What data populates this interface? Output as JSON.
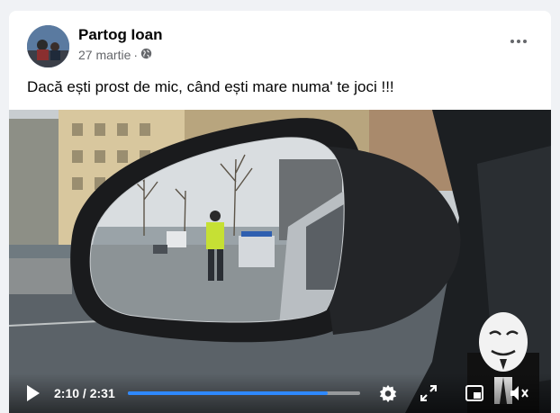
{
  "post": {
    "author": "Partog Ioan",
    "date": "27 martie",
    "audience_icon": "globe-icon",
    "more_icon": "more-options-icon",
    "caption": "Dacă ești prost de mic, când ești mare numa' te joci !!!"
  },
  "video": {
    "current_time": "2:10",
    "duration": "2:31",
    "time_separator": " / ",
    "progress_fraction": 0.861,
    "accent_color": "#2e89ff",
    "controls": [
      "play-icon",
      "settings-gear-icon",
      "fullscreen-icon",
      "picture-in-picture-icon",
      "volume-muted-icon"
    ]
  }
}
